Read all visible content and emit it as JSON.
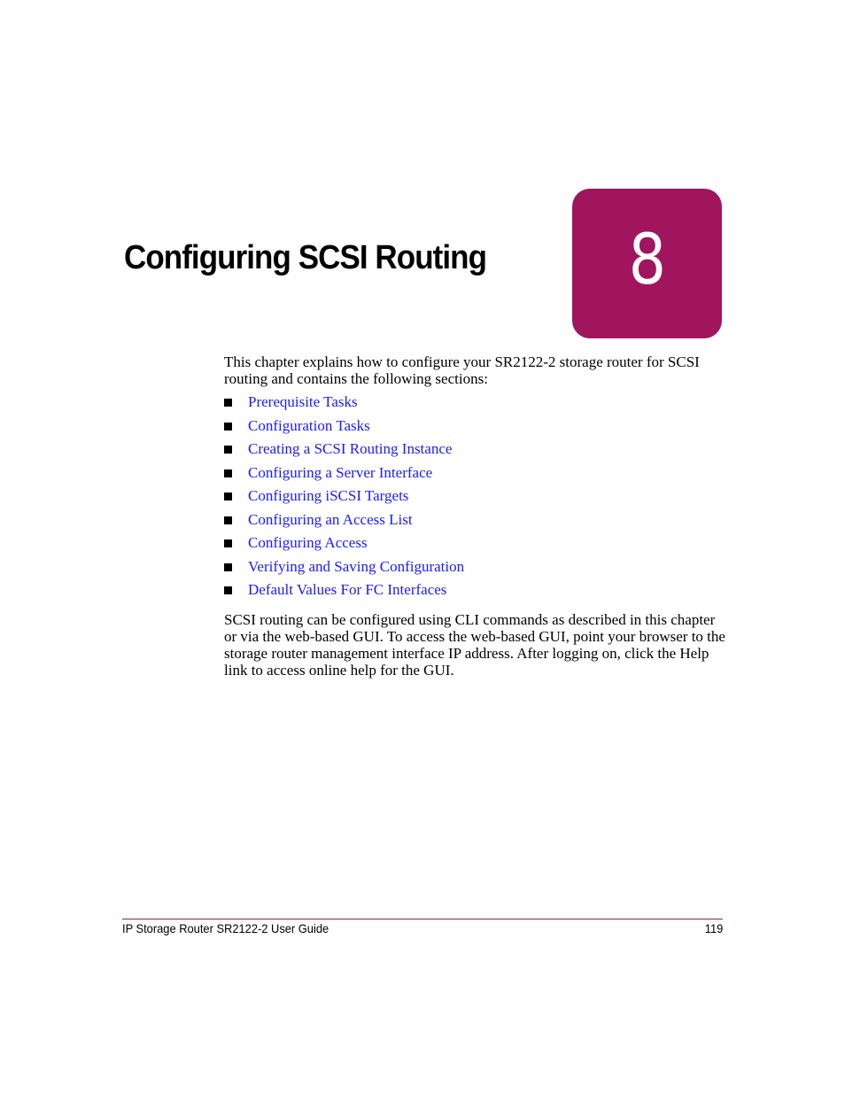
{
  "chapter": {
    "title": "Configuring SCSI Routing",
    "number": "8",
    "accent_color": "#a0155e"
  },
  "intro": "This chapter explains how to configure your SR2122-2 storage router for SCSI routing and contains the following sections:",
  "sections": [
    {
      "label": "Prerequisite Tasks"
    },
    {
      "label": "Configuration Tasks"
    },
    {
      "label": "Creating a SCSI Routing Instance"
    },
    {
      "label": "Configuring a Server Interface"
    },
    {
      "label": "Configuring iSCSI Targets"
    },
    {
      "label": "Configuring an Access List"
    },
    {
      "label": "Configuring Access"
    },
    {
      "label": "Verifying and Saving Configuration"
    },
    {
      "label": "Default Values For FC Interfaces"
    }
  ],
  "closing": "SCSI routing can be configured using CLI commands as described in this chapter or via the web-based GUI. To access the web-based GUI, point your browser to the storage router management interface IP address. After logging on, click the Help link to access online help for the GUI.",
  "footer": {
    "doc_title": "IP Storage Router SR2122-2 User Guide",
    "page_number": "119"
  }
}
